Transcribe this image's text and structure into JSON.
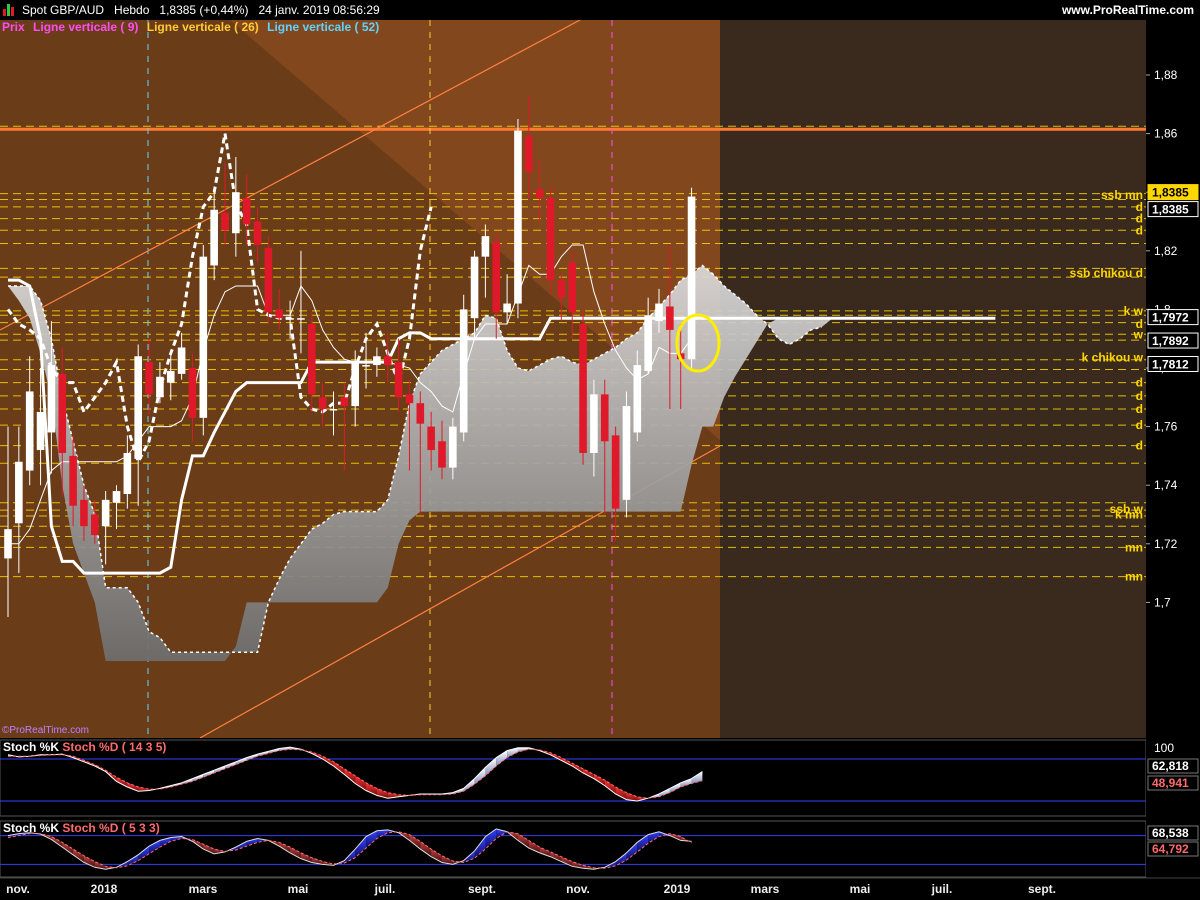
{
  "header": {
    "title": "Spot GBP/AUD   Hebdo   1,8385 (+0,44%)   24 janv. 2019 08:56:29",
    "brand": "www.ProRealTime.com"
  },
  "legend": [
    {
      "label": "Prix",
      "color": "#ff4df5"
    },
    {
      "label": "Ligne verticale ( 9)",
      "color": "#ff4df5"
    },
    {
      "label": "Ligne verticale ( 26)",
      "color": "#ffcc33"
    },
    {
      "label": "Ligne verticale ( 52)",
      "color": "#5fd3ff"
    }
  ],
  "colors": {
    "bull": "#ffffff",
    "bear": "#e0192a",
    "bg": "#5a3315",
    "cloud": "#d9d9d9",
    "hline": "#ffd700",
    "trend": "#ff8040",
    "orange_line": "#ff7a30"
  },
  "chart_data": [
    {
      "type": "candlestick",
      "title": "Spot GBP/AUD",
      "timeframe": "Hebdo",
      "last": "1,8385",
      "change": "+0,44%",
      "ylim": [
        1.68,
        1.895
      ],
      "yticks": [
        "1,88",
        "1,86",
        "1,84",
        "1,82",
        "1,8",
        "1,78",
        "1,76",
        "1,74",
        "1,72",
        "1,7"
      ],
      "xticks": [
        "nov.",
        "2018",
        "mars",
        "mai",
        "juil.",
        "sept.",
        "nov.",
        "2019",
        "mars",
        "mai",
        "juil.",
        "sept."
      ],
      "price_tags": [
        {
          "text": "1,8385",
          "value": 1.8385,
          "highlight": true
        },
        {
          "text": "1,8385",
          "value": 1.8385
        },
        {
          "text": "1,7972",
          "value": 1.7972
        },
        {
          "text": "1,7892",
          "value": 1.7892
        },
        {
          "text": "1,7812",
          "value": 1.7812
        }
      ],
      "level_labels": [
        {
          "text": "ssb mn",
          "value": 1.839
        },
        {
          "text": "d",
          "value": 1.835
        },
        {
          "text": "d",
          "value": 1.831
        },
        {
          "text": "d",
          "value": 1.827
        },
        {
          "text": "ssb chikou d",
          "value": 1.8125
        },
        {
          "text": "k w",
          "value": 1.7995
        },
        {
          "text": "d",
          "value": 1.795
        },
        {
          "text": "w",
          "value": 1.7915
        },
        {
          "text": "k chikou w",
          "value": 1.7835
        },
        {
          "text": "d",
          "value": 1.775
        },
        {
          "text": "d",
          "value": 1.7705
        },
        {
          "text": "d",
          "value": 1.766
        },
        {
          "text": "d",
          "value": 1.7605
        },
        {
          "text": "d",
          "value": 1.7535
        },
        {
          "text": "ssb w",
          "value": 1.7318
        },
        {
          "text": "k mn",
          "value": 1.73
        },
        {
          "text": "mn",
          "value": 1.7188
        },
        {
          "text": "mn",
          "value": 1.7088
        }
      ],
      "horizontal_lines": [
        1.8615,
        1.8625,
        1.8395,
        1.8375,
        1.835,
        1.831,
        1.827,
        1.8225,
        1.814,
        1.811,
        1.7995,
        1.798,
        1.7955,
        1.7915,
        1.7895,
        1.7828,
        1.7795,
        1.775,
        1.7705,
        1.766,
        1.7605,
        1.7535,
        1.7475,
        1.734,
        1.7315,
        1.7295,
        1.726,
        1.7225,
        1.7188,
        1.7088
      ],
      "orange_lines": [
        1.8615,
        1.7255
      ],
      "candles": [
        {
          "o": 1.715,
          "c": 1.725,
          "h": 1.76,
          "l": 1.695
        },
        {
          "o": 1.727,
          "c": 1.748,
          "h": 1.76,
          "l": 1.71
        },
        {
          "o": 1.745,
          "c": 1.772,
          "h": 1.784,
          "l": 1.74
        },
        {
          "o": 1.752,
          "c": 1.765,
          "h": 1.78,
          "l": 1.74
        },
        {
          "o": 1.758,
          "c": 1.781,
          "h": 1.796,
          "l": 1.744
        },
        {
          "o": 1.778,
          "c": 1.751,
          "h": 1.787,
          "l": 1.736
        },
        {
          "o": 1.75,
          "c": 1.733,
          "h": 1.757,
          "l": 1.726
        },
        {
          "o": 1.735,
          "c": 1.726,
          "h": 1.74,
          "l": 1.721
        },
        {
          "o": 1.73,
          "c": 1.723,
          "h": 1.735,
          "l": 1.72
        },
        {
          "o": 1.726,
          "c": 1.735,
          "h": 1.738,
          "l": 1.713
        },
        {
          "o": 1.734,
          "c": 1.738,
          "h": 1.74,
          "l": 1.725
        },
        {
          "o": 1.737,
          "c": 1.751,
          "h": 1.757,
          "l": 1.732
        },
        {
          "o": 1.749,
          "c": 1.784,
          "h": 1.788,
          "l": 1.733
        },
        {
          "o": 1.782,
          "c": 1.771,
          "h": 1.79,
          "l": 1.764
        },
        {
          "o": 1.77,
          "c": 1.777,
          "h": 1.782,
          "l": 1.768
        },
        {
          "o": 1.775,
          "c": 1.779,
          "h": 1.786,
          "l": 1.769
        },
        {
          "o": 1.778,
          "c": 1.787,
          "h": 1.792,
          "l": 1.776
        },
        {
          "o": 1.78,
          "c": 1.763,
          "h": 1.785,
          "l": 1.755
        },
        {
          "o": 1.763,
          "c": 1.818,
          "h": 1.822,
          "l": 1.757
        },
        {
          "o": 1.815,
          "c": 1.834,
          "h": 1.842,
          "l": 1.81
        },
        {
          "o": 1.833,
          "c": 1.827,
          "h": 1.85,
          "l": 1.822
        },
        {
          "o": 1.826,
          "c": 1.84,
          "h": 1.852,
          "l": 1.818
        },
        {
          "o": 1.838,
          "c": 1.829,
          "h": 1.846,
          "l": 1.822
        },
        {
          "o": 1.83,
          "c": 1.822,
          "h": 1.835,
          "l": 1.816
        },
        {
          "o": 1.821,
          "c": 1.799,
          "h": 1.825,
          "l": 1.795
        },
        {
          "o": 1.8,
          "c": 1.797,
          "h": 1.807,
          "l": 1.793
        },
        {
          "o": 1.797,
          "c": 1.797,
          "h": 1.803,
          "l": 1.79
        },
        {
          "o": 1.797,
          "c": 1.797,
          "h": 1.82,
          "l": 1.785
        },
        {
          "o": 1.795,
          "c": 1.771,
          "h": 1.799,
          "l": 1.765
        },
        {
          "o": 1.77,
          "c": 1.766,
          "h": 1.775,
          "l": 1.76
        },
        {
          "o": 1.766,
          "c": 1.766,
          "h": 1.772,
          "l": 1.757
        },
        {
          "o": 1.77,
          "c": 1.767,
          "h": 1.775,
          "l": 1.745
        },
        {
          "o": 1.767,
          "c": 1.782,
          "h": 1.786,
          "l": 1.76
        },
        {
          "o": 1.781,
          "c": 1.781,
          "h": 1.792,
          "l": 1.773
        },
        {
          "o": 1.781,
          "c": 1.784,
          "h": 1.787,
          "l": 1.777
        },
        {
          "o": 1.784,
          "c": 1.781,
          "h": 1.792,
          "l": 1.775
        },
        {
          "o": 1.782,
          "c": 1.77,
          "h": 1.79,
          "l": 1.765
        },
        {
          "o": 1.771,
          "c": 1.768,
          "h": 1.776,
          "l": 1.745
        },
        {
          "o": 1.768,
          "c": 1.761,
          "h": 1.772,
          "l": 1.73
        },
        {
          "o": 1.76,
          "c": 1.752,
          "h": 1.765,
          "l": 1.745
        },
        {
          "o": 1.755,
          "c": 1.746,
          "h": 1.762,
          "l": 1.742
        },
        {
          "o": 1.746,
          "c": 1.76,
          "h": 1.763,
          "l": 1.742
        },
        {
          "o": 1.758,
          "c": 1.8,
          "h": 1.805,
          "l": 1.755
        },
        {
          "o": 1.797,
          "c": 1.818,
          "h": 1.82,
          "l": 1.79
        },
        {
          "o": 1.818,
          "c": 1.825,
          "h": 1.829,
          "l": 1.804
        },
        {
          "o": 1.823,
          "c": 1.799,
          "h": 1.826,
          "l": 1.79
        },
        {
          "o": 1.799,
          "c": 1.802,
          "h": 1.812,
          "l": 1.795
        },
        {
          "o": 1.802,
          "c": 1.861,
          "h": 1.865,
          "l": 1.797
        },
        {
          "o": 1.859,
          "c": 1.847,
          "h": 1.873,
          "l": 1.838
        },
        {
          "o": 1.841,
          "c": 1.838,
          "h": 1.851,
          "l": 1.83
        },
        {
          "o": 1.838,
          "c": 1.81,
          "h": 1.842,
          "l": 1.805
        },
        {
          "o": 1.81,
          "c": 1.804,
          "h": 1.812,
          "l": 1.796
        },
        {
          "o": 1.816,
          "c": 1.799,
          "h": 1.82,
          "l": 1.79
        },
        {
          "o": 1.795,
          "c": 1.751,
          "h": 1.8,
          "l": 1.747
        },
        {
          "o": 1.751,
          "c": 1.771,
          "h": 1.776,
          "l": 1.743
        },
        {
          "o": 1.771,
          "c": 1.755,
          "h": 1.776,
          "l": 1.73
        },
        {
          "o": 1.757,
          "c": 1.732,
          "h": 1.76,
          "l": 1.721
        },
        {
          "o": 1.735,
          "c": 1.767,
          "h": 1.772,
          "l": 1.729
        },
        {
          "o": 1.758,
          "c": 1.781,
          "h": 1.786,
          "l": 1.755
        },
        {
          "o": 1.779,
          "c": 1.798,
          "h": 1.804,
          "l": 1.778
        },
        {
          "o": 1.796,
          "c": 1.802,
          "h": 1.807,
          "l": 1.792
        },
        {
          "o": 1.801,
          "c": 1.793,
          "h": 1.822,
          "l": 1.766
        },
        {
          "o": 1.785,
          "c": 1.783,
          "h": 1.795,
          "l": 1.766
        },
        {
          "o": 1.783,
          "c": 1.8385,
          "h": 1.8415,
          "l": 1.78
        }
      ],
      "tenkan": [
        1.72,
        1.72,
        1.725,
        1.735,
        1.745,
        1.748,
        1.748,
        1.748,
        1.748,
        1.748,
        1.748,
        1.75,
        1.755,
        1.76,
        1.76,
        1.76,
        1.762,
        1.77,
        1.786,
        1.798,
        1.806,
        1.808,
        1.808,
        1.808,
        1.798,
        1.798,
        1.798,
        1.808,
        1.803,
        1.793,
        1.787,
        1.783,
        1.782,
        1.782,
        1.782,
        1.782,
        1.781,
        1.78,
        1.775,
        1.772,
        1.767,
        1.765,
        1.778,
        1.79,
        1.795,
        1.795,
        1.795,
        1.805,
        1.815,
        1.812,
        1.812,
        1.818,
        1.822,
        1.822,
        1.806,
        1.795,
        1.786,
        1.78,
        1.776,
        1.778,
        1.787,
        1.785,
        1.785,
        1.79
      ],
      "kijun": [
        1.81,
        1.81,
        1.808,
        1.79,
        1.726,
        1.714,
        1.714,
        1.71,
        1.71,
        1.71,
        1.71,
        1.71,
        1.71,
        1.71,
        1.71,
        1.712,
        1.735,
        1.75,
        1.75,
        1.758,
        1.765,
        1.772,
        1.775,
        1.775,
        1.775,
        1.775,
        1.775,
        1.775,
        1.782,
        1.782,
        1.782,
        1.782,
        1.782,
        1.782,
        1.782,
        1.782,
        1.79,
        1.792,
        1.792,
        1.79,
        1.79,
        1.79,
        1.79,
        1.79,
        1.79,
        1.79,
        1.79,
        1.79,
        1.79,
        1.79,
        1.797,
        1.797,
        1.797,
        1.797,
        1.797,
        1.797,
        1.797,
        1.797,
        1.797,
        1.797,
        1.797,
        1.797,
        1.797,
        1.797,
        1.797,
        1.797,
        1.797,
        1.797,
        1.797,
        1.797,
        1.797,
        1.797,
        1.797,
        1.797,
        1.797,
        1.797,
        1.797,
        1.797,
        1.797,
        1.797,
        1.797,
        1.797,
        1.797,
        1.797,
        1.797,
        1.797,
        1.797,
        1.797,
        1.797,
        1.797,
        1.797,
        1.797
      ],
      "chikou": [
        1.8,
        1.795,
        1.793,
        1.79,
        1.78,
        1.775,
        1.775,
        1.765,
        1.77,
        1.775,
        1.782,
        1.76,
        1.748,
        1.755,
        1.773,
        1.785,
        1.795,
        1.818,
        1.835,
        1.84,
        1.86,
        1.836,
        1.829,
        1.8,
        1.798,
        1.797,
        1.797,
        1.77,
        1.766,
        1.765,
        1.768,
        1.768,
        1.78,
        1.79,
        1.795,
        1.785,
        1.775,
        1.79,
        1.82,
        1.835
      ],
      "cloud_top": [
        1.808,
        1.808,
        1.808,
        1.803,
        1.79,
        1.77,
        1.755,
        1.74,
        1.73,
        1.705,
        1.705,
        1.705,
        1.7,
        1.69,
        1.688,
        1.683,
        1.683,
        1.683,
        1.683,
        1.683,
        1.683,
        1.683,
        1.683,
        1.683,
        1.7,
        1.708,
        1.715,
        1.72,
        1.725,
        1.727,
        1.73,
        1.731,
        1.731,
        1.731,
        1.731,
        1.735,
        1.75,
        1.768,
        1.778,
        1.782,
        1.786,
        1.788,
        1.79,
        1.792,
        1.798,
        1.797,
        1.786,
        1.78,
        1.779,
        1.781,
        1.783,
        1.784,
        1.782,
        1.781,
        1.783,
        1.785,
        1.787,
        1.79,
        1.792,
        1.797,
        1.801,
        1.805,
        1.81,
        1.812,
        1.815,
        1.812,
        1.808,
        1.805,
        1.802,
        1.798,
        1.795,
        1.79,
        1.788,
        1.79,
        1.793,
        1.794
      ],
      "cloud_bot": [
        1.808,
        1.803,
        1.797,
        1.785,
        1.77,
        1.74,
        1.72,
        1.71,
        1.7,
        1.68,
        1.68,
        1.68,
        1.68,
        1.68,
        1.68,
        1.68,
        1.68,
        1.68,
        1.68,
        1.68,
        1.68,
        1.685,
        1.7,
        1.7,
        1.7,
        1.7,
        1.7,
        1.7,
        1.7,
        1.7,
        1.7,
        1.7,
        1.7,
        1.7,
        1.7,
        1.705,
        1.72,
        1.728,
        1.731,
        1.731,
        1.731,
        1.731,
        1.731,
        1.731,
        1.731,
        1.731,
        1.731,
        1.731,
        1.731,
        1.731,
        1.731,
        1.731,
        1.731,
        1.731,
        1.731,
        1.731,
        1.731,
        1.731,
        1.731,
        1.731,
        1.731,
        1.731,
        1.731,
        1.747,
        1.76,
        1.76,
        1.77,
        1.777,
        1.783,
        1.789,
        1.795,
        1.797,
        1.797,
        1.797,
        1.797,
        1.797,
        1.797
      ]
    },
    {
      "type": "area",
      "title": "Stoch %K / Stoch %D ( 14 3 5)",
      "series": [
        {
          "name": "Stoch %K"
        },
        {
          "name": "Stoch %D ( 14 3 5)"
        }
      ],
      "ylim": [
        0,
        100
      ],
      "yticks": [
        "100"
      ],
      "value_labels": [
        {
          "text": "62,818",
          "color": "#ffffff"
        },
        {
          "text": "48,941",
          "color": "#ff6a6a"
        }
      ],
      "k": [
        86,
        83,
        84,
        86,
        86,
        87,
        82,
        76,
        70,
        62,
        48,
        40,
        34,
        35,
        38,
        42,
        46,
        52,
        58,
        64,
        70,
        76,
        82,
        87,
        91,
        95,
        97,
        94,
        88,
        80,
        70,
        58,
        45,
        35,
        28,
        24,
        26,
        28,
        30,
        30,
        30,
        32,
        38,
        52,
        68,
        82,
        92,
        96,
        96,
        92,
        86,
        78,
        70,
        60,
        52,
        42,
        30,
        22,
        20,
        24,
        30,
        38,
        46,
        52,
        62
      ],
      "d": [
        84,
        84,
        84,
        85,
        86,
        86,
        84,
        78,
        72,
        64,
        54,
        46,
        40,
        37,
        37,
        40,
        44,
        48,
        54,
        60,
        66,
        72,
        78,
        84,
        88,
        92,
        94,
        93,
        90,
        84,
        76,
        66,
        56,
        46,
        38,
        32,
        29,
        28,
        29,
        29,
        29,
        30,
        34,
        44,
        56,
        70,
        82,
        90,
        94,
        93,
        89,
        82,
        74,
        66,
        58,
        50,
        40,
        32,
        26,
        24,
        26,
        32,
        40,
        45,
        49
      ]
    },
    {
      "type": "area",
      "title": "Stoch %K / Stoch %D ( 5 3 3)",
      "series": [
        {
          "name": "Stoch %K"
        },
        {
          "name": "Stoch %D ( 5 3 3)"
        }
      ],
      "ylim": [
        0,
        100
      ],
      "yticks": [
        "100"
      ],
      "value_labels": [
        {
          "text": "68,538",
          "color": "#ffffff"
        },
        {
          "text": "64,792",
          "color": "#ff6a6a"
        }
      ],
      "k": [
        80,
        84,
        86,
        83,
        72,
        56,
        40,
        24,
        14,
        10,
        14,
        26,
        40,
        58,
        70,
        76,
        78,
        68,
        52,
        42,
        46,
        56,
        68,
        74,
        70,
        58,
        44,
        32,
        24,
        20,
        18,
        28,
        52,
        78,
        90,
        92,
        86,
        70,
        52,
        36,
        24,
        20,
        28,
        48,
        78,
        94,
        88,
        70,
        54,
        44,
        36,
        26,
        16,
        12,
        10,
        14,
        26,
        44,
        66,
        82,
        88,
        80,
        70,
        68
      ],
      "d": [
        76,
        80,
        84,
        84,
        78,
        66,
        52,
        38,
        26,
        16,
        13,
        17,
        28,
        42,
        56,
        68,
        74,
        72,
        62,
        52,
        47,
        50,
        58,
        66,
        70,
        66,
        56,
        44,
        34,
        26,
        21,
        23,
        34,
        54,
        74,
        86,
        88,
        82,
        68,
        52,
        38,
        27,
        24,
        33,
        52,
        74,
        88,
        84,
        70,
        56,
        46,
        36,
        26,
        18,
        13,
        12,
        17,
        29,
        46,
        64,
        78,
        84,
        78,
        65
      ]
    }
  ]
}
